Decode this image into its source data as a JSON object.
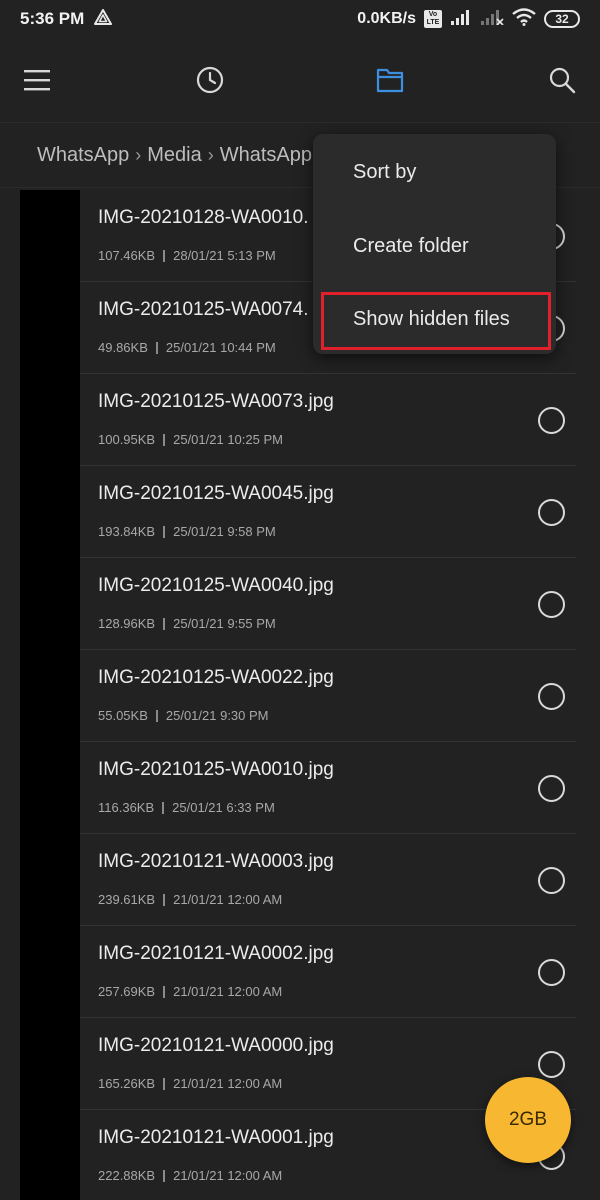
{
  "status_bar": {
    "time": "5:36 PM",
    "net_speed": "0.0KB/s",
    "volte": "Vo LTE",
    "battery": "32"
  },
  "toolbar": {
    "menu_icon": "hamburger-icon",
    "recent_icon": "clock-icon",
    "files_icon": "folder-icon",
    "search_icon": "search-icon",
    "accent_color": "#3d8fe0"
  },
  "breadcrumb": {
    "items": [
      "WhatsApp",
      "Media",
      "WhatsApp"
    ]
  },
  "menu": {
    "items": [
      {
        "label": "Sort by"
      },
      {
        "label": "Create folder"
      },
      {
        "label": "Show hidden files"
      }
    ],
    "highlight_color": "#e0202a"
  },
  "files": [
    {
      "name": "IMG-20210128-WA0010.",
      "size": "107.46KB",
      "date": "28/01/21 5:13 PM"
    },
    {
      "name": "IMG-20210125-WA0074.",
      "size": "49.86KB",
      "date": "25/01/21 10:44 PM"
    },
    {
      "name": "IMG-20210125-WA0073.jpg",
      "size": "100.95KB",
      "date": "25/01/21 10:25 PM"
    },
    {
      "name": "IMG-20210125-WA0045.jpg",
      "size": "193.84KB",
      "date": "25/01/21 9:58 PM"
    },
    {
      "name": "IMG-20210125-WA0040.jpg",
      "size": "128.96KB",
      "date": "25/01/21 9:55 PM"
    },
    {
      "name": "IMG-20210125-WA0022.jpg",
      "size": "55.05KB",
      "date": "25/01/21 9:30 PM"
    },
    {
      "name": "IMG-20210125-WA0010.jpg",
      "size": "116.36KB",
      "date": "25/01/21 6:33 PM"
    },
    {
      "name": "IMG-20210121-WA0003.jpg",
      "size": "239.61KB",
      "date": "21/01/21 12:00 AM"
    },
    {
      "name": "IMG-20210121-WA0002.jpg",
      "size": "257.69KB",
      "date": "21/01/21 12:00 AM"
    },
    {
      "name": "IMG-20210121-WA0000.jpg",
      "size": "165.26KB",
      "date": "21/01/21 12:00 AM"
    },
    {
      "name": "IMG-20210121-WA0001.jpg",
      "size": "222.88KB",
      "date": "21/01/21 12:00 AM"
    }
  ],
  "fab": {
    "label": "2GB",
    "color": "#f7b731"
  }
}
